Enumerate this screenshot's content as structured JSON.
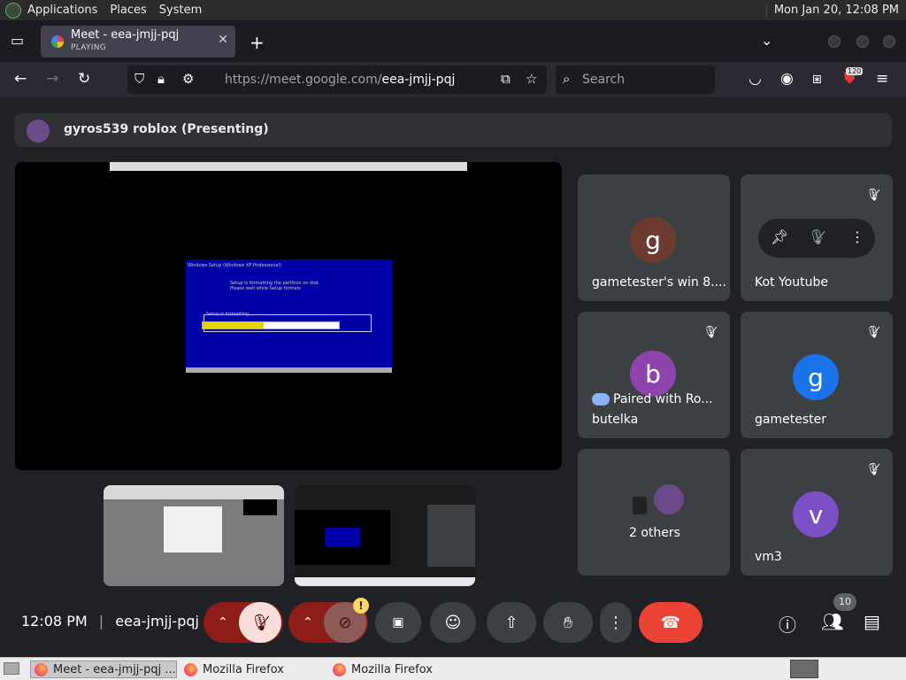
{
  "panel": {
    "menus": [
      "Applications",
      "Places",
      "System"
    ],
    "clock": "Mon Jan 20, 12:08 PM"
  },
  "browser": {
    "tab": {
      "title": "Meet - eea-jmjj-pqj",
      "status": "PLAYING"
    },
    "url_host": "https://meet.google.com/",
    "url_path": "eea-jmjj-pqj",
    "search_placeholder": "Search",
    "extension_badge": "120"
  },
  "meet": {
    "presenting_label": "gyros539 roblox (Presenting)",
    "share_screen": {
      "header": "Windows Setup (Windows XP Professional)",
      "body": [
        "Setup is formatting the partition on disk",
        "Please wait while Setup formats"
      ],
      "progress_label": "Setup is formatting...",
      "progress_fraction": 0.45
    },
    "participants": [
      {
        "name": "gametester's win 8....",
        "initial": "g",
        "color": "#6d3a2f",
        "muted": false
      },
      {
        "name": "Kot Youtube",
        "initial": "",
        "color": "#3c4043",
        "muted": true,
        "hover": true
      },
      {
        "name": "butelka",
        "initial": "b",
        "color": "#8e44ad",
        "muted": true,
        "paired": "Paired with Ro..."
      },
      {
        "name": "gametester",
        "initial": "g",
        "color": "#1a73e8",
        "muted": true
      },
      {
        "name": "2 others",
        "initial": "",
        "color": "#3c4043",
        "muted": false
      },
      {
        "name": "vm3",
        "initial": "v",
        "color": "#7b4fc6",
        "muted": true
      }
    ],
    "controls": {
      "time": "12:08 PM",
      "meeting_code": "eea-jmjj-pqj",
      "people_count": "10",
      "warning_glyph": "!"
    }
  },
  "taskbar": {
    "items": [
      "Meet - eea-jmjj-pqj ...",
      "Mozilla Firefox",
      "Mozilla Firefox"
    ]
  }
}
